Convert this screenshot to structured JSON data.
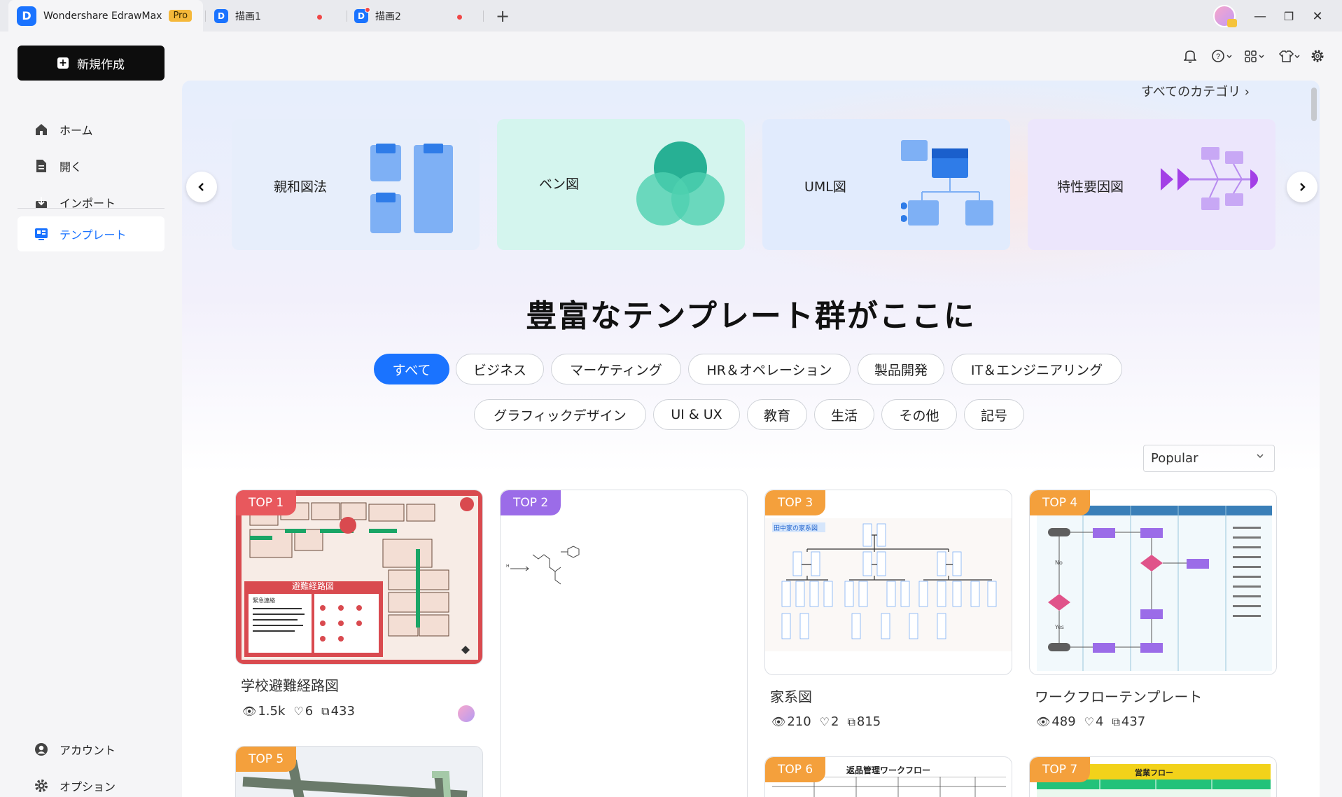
{
  "titlebar": {
    "app_name": "Wondershare EdrawMax",
    "pro_badge": "Pro",
    "tabs": [
      {
        "label": "描画1"
      },
      {
        "label": "描画2"
      }
    ],
    "new_tab": "+",
    "minimize": "—",
    "restore": "❐",
    "close": "✕"
  },
  "sidebar": {
    "new_button": "新規作成",
    "items": [
      {
        "label": "ホーム",
        "icon": "home-icon"
      },
      {
        "label": "開く",
        "icon": "file-icon"
      },
      {
        "label": "インポート",
        "icon": "import-icon"
      },
      {
        "label": "テンプレート",
        "icon": "template-icon"
      }
    ],
    "bottom": [
      {
        "label": "アカウント",
        "icon": "account-icon"
      },
      {
        "label": "オプション",
        "icon": "settings-icon"
      }
    ]
  },
  "utility_icons": [
    "bell-icon",
    "help-icon",
    "apps-icon",
    "shirt-icon",
    "gear-icon"
  ],
  "hero": {
    "all_categories": "すべてのカテゴリ ›",
    "categories": [
      {
        "label": "親和図法",
        "color": "#e7eefb"
      },
      {
        "label": "ベン図",
        "color": "#d4f5ee"
      },
      {
        "label": "UML図",
        "color": "#e1ebfd"
      },
      {
        "label": "特性要因図",
        "color": "#ece6fc"
      }
    ],
    "title": "豊富なテンプレート群がここに",
    "filters_row1": [
      "すべて",
      "ビジネス",
      "マーケティング",
      "HR＆オペレーション",
      "製品開発",
      "IT＆エンジニアリング"
    ],
    "filters_row2": [
      "グラフィックデザイン",
      "UI & UX",
      "教育",
      "生活",
      "その他",
      "記号"
    ],
    "active_filter": "すべて"
  },
  "sort": {
    "value": "Popular"
  },
  "templates": [
    {
      "rank": "TOP 1",
      "name": "学校避難経路図",
      "views": "1.5k",
      "likes": "6",
      "copies": "433"
    },
    {
      "rank": "TOP 2",
      "name": "",
      "views": "",
      "likes": "",
      "copies": ""
    },
    {
      "rank": "TOP 3",
      "name": "家系図",
      "views": "210",
      "likes": "2",
      "copies": "815"
    },
    {
      "rank": "TOP 4",
      "name": "ワークフローテンプレート",
      "views": "489",
      "likes": "4",
      "copies": "437"
    },
    {
      "rank": "TOP 5"
    },
    {
      "rank": "TOP 6",
      "heading": "返品管理ワークフロー"
    },
    {
      "rank": "TOP 7",
      "heading": "営業フロー"
    }
  ],
  "thumb_text": {
    "t1_banner": "避難経路図",
    "t1_label": "緊急連絡",
    "t3_label": "田中家の家系図",
    "t4_no": "No",
    "t4_yes": "Yes"
  },
  "colors": {
    "accent": "#1a73ff",
    "top1": "#e8585d",
    "top2": "#9b6ce8",
    "top_other": "#f4a03c"
  }
}
